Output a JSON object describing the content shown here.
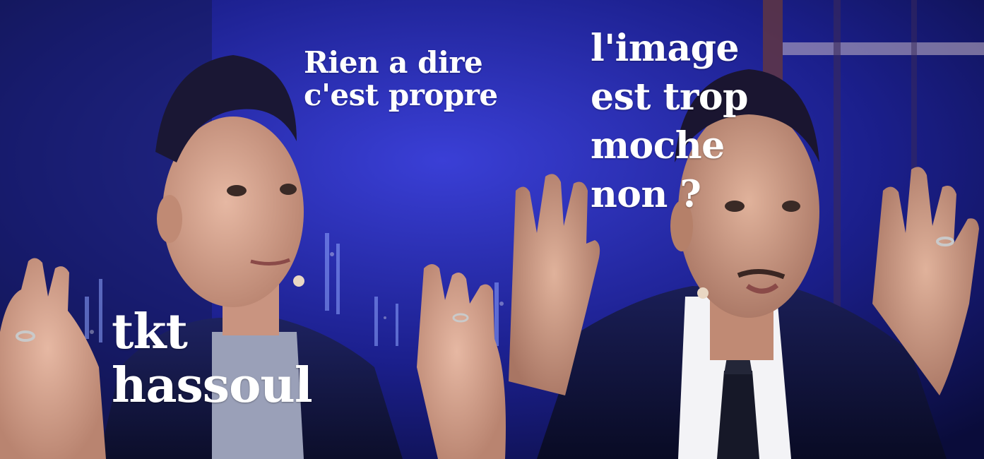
{
  "captions": {
    "top_center": "Rien a dire\nc'est propre",
    "top_right": "l'image\nest trop\nmoche\nnon ?",
    "bottom_left": "tkt\nhassoul"
  },
  "colors": {
    "caption_text": "#ffffff",
    "backdrop_blue": "#1a1f8a",
    "suit_dark": "#10122a",
    "skin": "#d9a78f"
  }
}
